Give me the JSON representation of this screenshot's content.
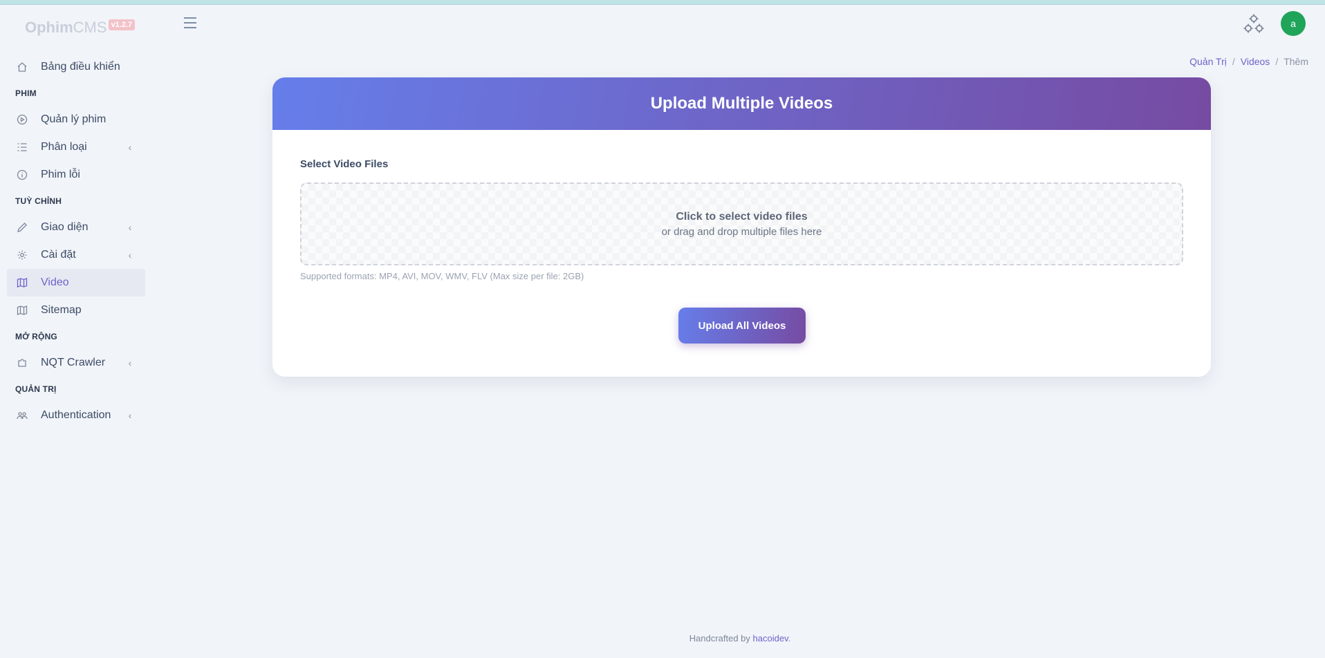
{
  "brand": {
    "name_bold": "Ophim",
    "name_light": "CMS",
    "version": "v1.2.7"
  },
  "sidebar": {
    "items": [
      {
        "type": "item",
        "label": "Bảng điều khiển",
        "icon": "home-icon"
      },
      {
        "type": "title",
        "label": "PHIM"
      },
      {
        "type": "item",
        "label": "Quản lý phim",
        "icon": "play-circle-icon"
      },
      {
        "type": "item",
        "label": "Phân loại",
        "icon": "list-icon",
        "chevron": true
      },
      {
        "type": "item",
        "label": "Phim lỗi",
        "icon": "info-icon"
      },
      {
        "type": "title",
        "label": "TUỲ CHỈNH"
      },
      {
        "type": "item",
        "label": "Giao diện",
        "icon": "pencil-icon",
        "chevron": true
      },
      {
        "type": "item",
        "label": "Cài đặt",
        "icon": "gear-icon",
        "chevron": true
      },
      {
        "type": "item",
        "label": "Video",
        "icon": "map-icon",
        "active": true
      },
      {
        "type": "item",
        "label": "Sitemap",
        "icon": "map-icon"
      },
      {
        "type": "title",
        "label": "MỞ RỘNG"
      },
      {
        "type": "item",
        "label": "NQT Crawler",
        "icon": "puzzle-icon",
        "chevron": true
      },
      {
        "type": "title",
        "label": "QUẢN TRỊ"
      },
      {
        "type": "item",
        "label": "Authentication",
        "icon": "users-icon",
        "chevron": true
      }
    ]
  },
  "header": {
    "avatar_letter": "a"
  },
  "breadcrumb": {
    "items": [
      "Quản Trị",
      "Videos",
      "Thêm"
    ],
    "separator": "/"
  },
  "card": {
    "title": "Upload Multiple Videos",
    "field_label": "Select Video Files",
    "dropzone_main": "Click to select video files",
    "dropzone_sub": "or drag and drop multiple files here",
    "formats_note": "Supported formats: MP4, AVI, MOV, WMV, FLV (Max size per file: 2GB)",
    "upload_button": "Upload All Videos"
  },
  "footer": {
    "prefix": "Handcrafted by ",
    "author": "hacoidev",
    "suffix": "."
  },
  "colors": {
    "accent": "#6f63c9",
    "gradient_start": "#667eea",
    "gradient_end": "#764ba2",
    "avatar_bg": "#1fa45a"
  }
}
